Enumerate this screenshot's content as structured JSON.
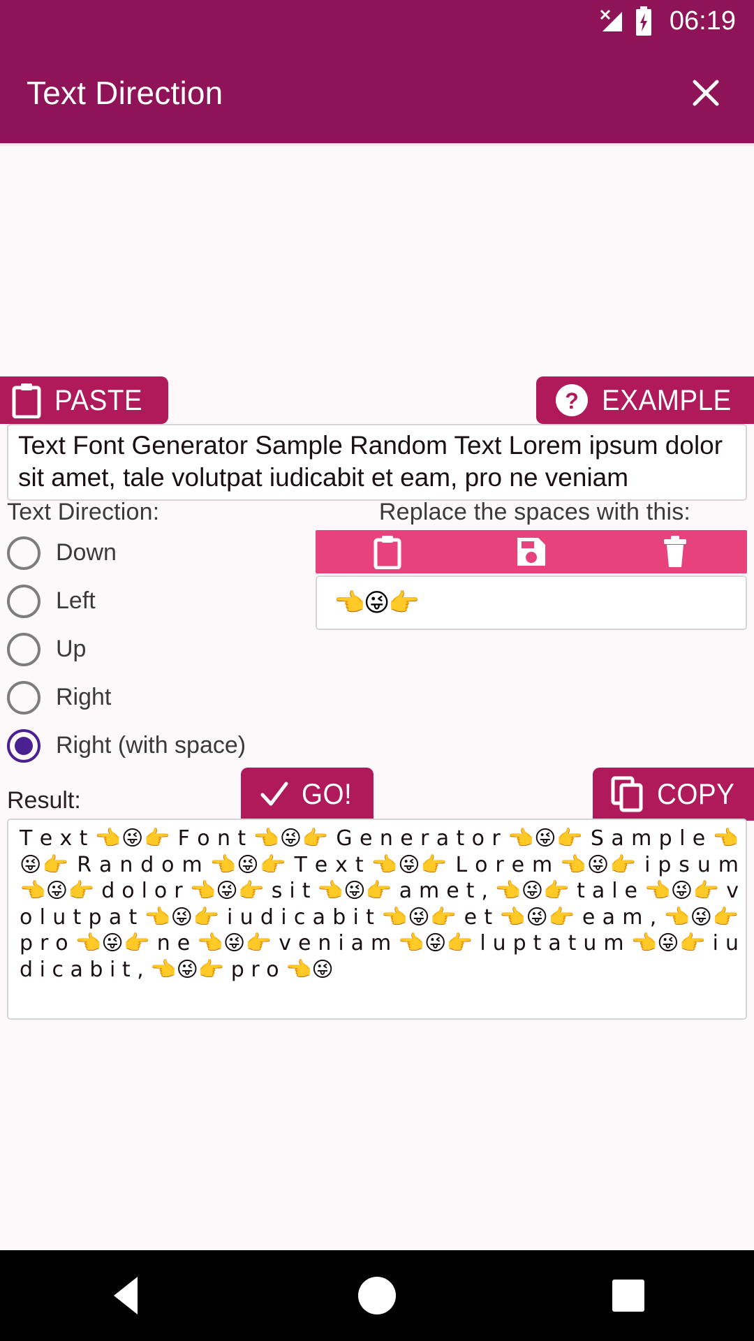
{
  "status_bar": {
    "time": "06:19",
    "icons": [
      "signal-no-service-icon",
      "battery-charging-icon"
    ]
  },
  "app_bar": {
    "title": "Text Direction",
    "close_icon": "close-icon"
  },
  "top_actions": {
    "paste": {
      "label": "PASTE",
      "icon": "clipboard-icon"
    },
    "example": {
      "label": "EXAMPLE",
      "icon": "help-circle-icon"
    }
  },
  "input": {
    "value": "Text Font Generator Sample Random Text Lorem ipsum dolor sit amet, tale volutpat iudicabit et eam, pro ne veniam",
    "placeholder": ""
  },
  "direction": {
    "label": "Text Direction:",
    "options": [
      {
        "label": "Down",
        "selected": false
      },
      {
        "label": "Left",
        "selected": false
      },
      {
        "label": "Up",
        "selected": false
      },
      {
        "label": "Right",
        "selected": false
      },
      {
        "label": "Right (with space)",
        "selected": true
      }
    ],
    "selected_value": "Right (with space)"
  },
  "replace": {
    "label": "Replace the spaces with this:",
    "toolbar": [
      {
        "name": "paste-separator-button",
        "icon": "clipboard-icon"
      },
      {
        "name": "save-separator-button",
        "icon": "floppy-disk-icon"
      },
      {
        "name": "delete-separator-button",
        "icon": "trash-icon"
      }
    ],
    "value": "👈😜👉"
  },
  "result": {
    "label": "Result:",
    "go": {
      "label": "GO!",
      "icon": "check-icon"
    },
    "copy": {
      "label": "COPY",
      "icon": "copy-icon"
    },
    "value": "T e x t  👈😜👉  F o n t  👈😜👉  G e n e r a t o r  👈😜👉  S a m p l e  👈😜👉  R a n d o m  👈😜👉  T e x t  👈😜👉  L o r e m  👈😜👉  i p s u m  👈😜👉  d o l o r  👈😜👉  s i t  👈😜👉  a m e t ,  👈😜👉  t a l e  👈😜👉  v o l u t p a t  👈😜👉  i u d i c a b i t  👈😜👉  e t  👈😜👉  e a m ,  👈😜👉  p r o  👈😜👉  n e  👈😜👉  v e n i a m  👈😜👉  l u p t a t u m  👈😜👉  i u d i c a b i t ,  👈😜👉  p r o  👈😜"
  },
  "nav_bar": {
    "buttons": [
      {
        "name": "nav-back-button",
        "icon": "back-triangle-icon"
      },
      {
        "name": "nav-home-button",
        "icon": "home-circle-icon"
      },
      {
        "name": "nav-recents-button",
        "icon": "recents-square-icon"
      }
    ]
  },
  "colors": {
    "app_bar": "#8E1457",
    "button": "#B01A5B",
    "toolbar_pink": "#E8427C",
    "accent_selected": "#4B2091",
    "page_bg": "#FDF8F9"
  }
}
